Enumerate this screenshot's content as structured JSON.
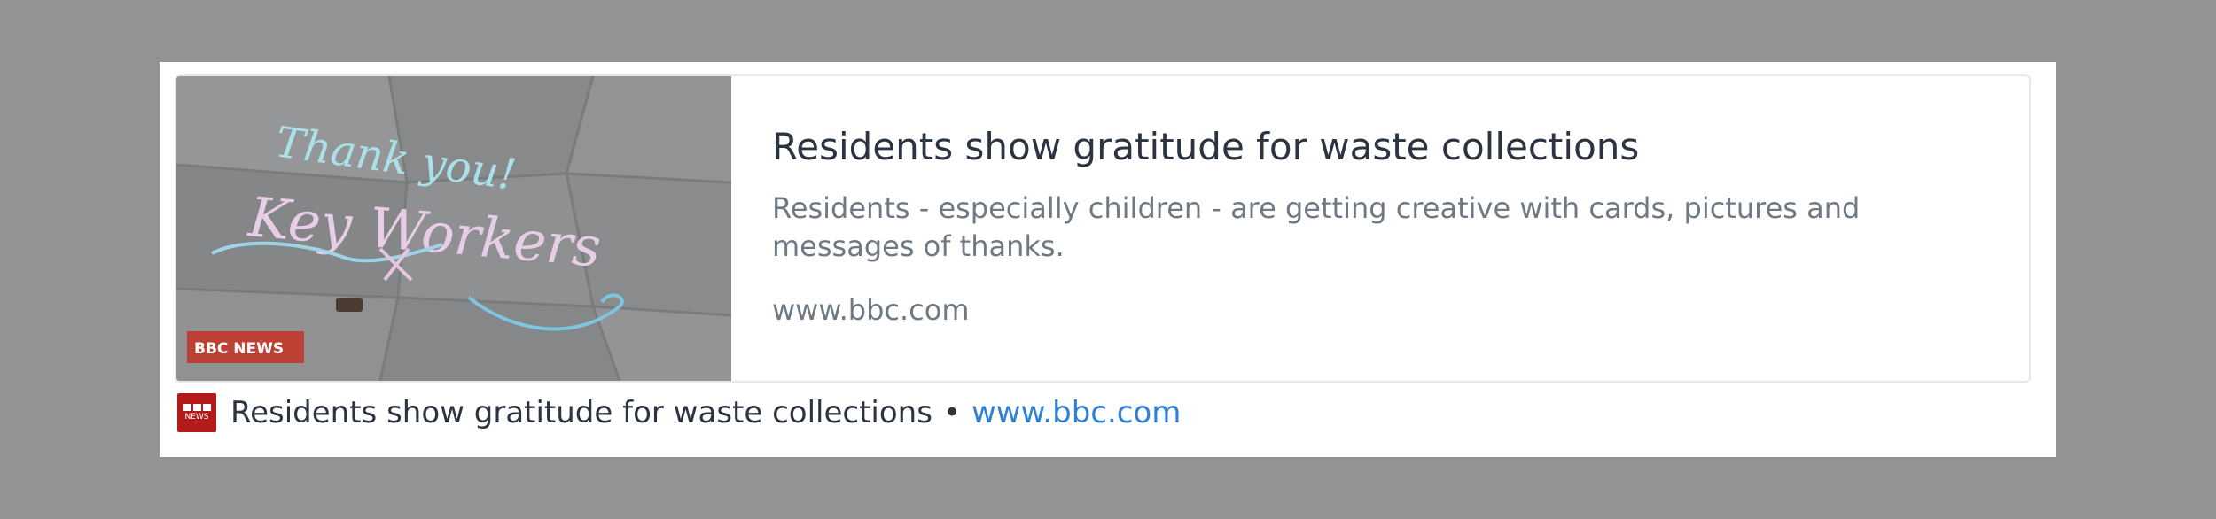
{
  "card": {
    "title": "Residents show gratitude for waste collections",
    "description": "Residents - especially children - are getting creative with cards, pictures and messages of thanks.",
    "domain": "www.bbc.com",
    "thumbnail": {
      "chalk_lines": [
        "Thank you!",
        "Key Workers"
      ],
      "badge": "BBC NEWS",
      "badge_color": "#c0392b"
    }
  },
  "footer": {
    "title": "Residents show gratitude for waste collections",
    "separator": "•",
    "link": "www.bbc.com",
    "favicon": "bbc-news-icon",
    "favicon_text": "NEWS",
    "favicon_color": "#b31b1b",
    "link_color": "#2f80d6"
  }
}
